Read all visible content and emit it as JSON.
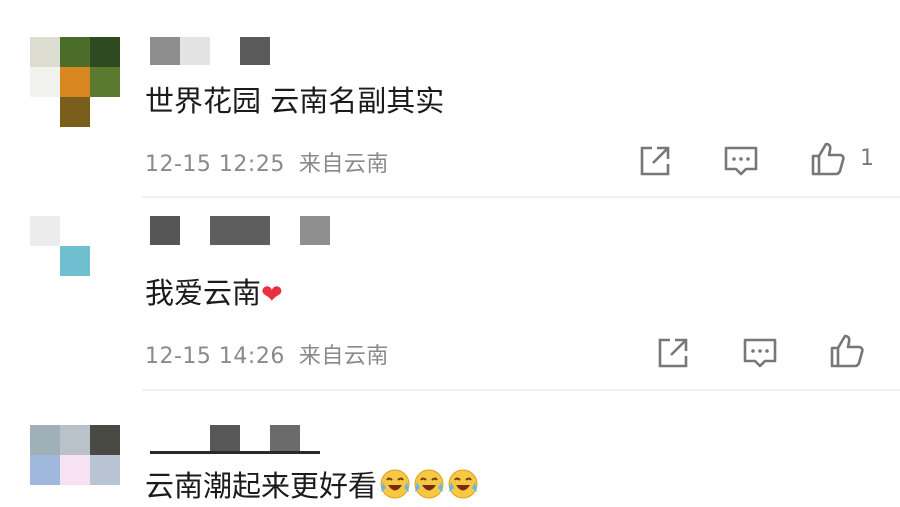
{
  "comments": [
    {
      "content": "世界花园 云南名副其实",
      "time": "12-15 12:25",
      "location": "来自云南",
      "likes": "1"
    },
    {
      "content": "我爱云南",
      "emoji": "❤",
      "time": "12-15 14:26",
      "location": "来自云南",
      "likes": ""
    },
    {
      "content": "云南潮起来更好看",
      "emoji_name": "crying-laughing-emoji",
      "emoji_count": 3
    }
  ],
  "icons": {
    "share": "share-icon",
    "comment": "comment-icon",
    "like": "thumbs-up-icon"
  },
  "colors": {
    "meta_text": "#8a8a8a",
    "heart": "#e8313f",
    "icon": "#777777"
  }
}
